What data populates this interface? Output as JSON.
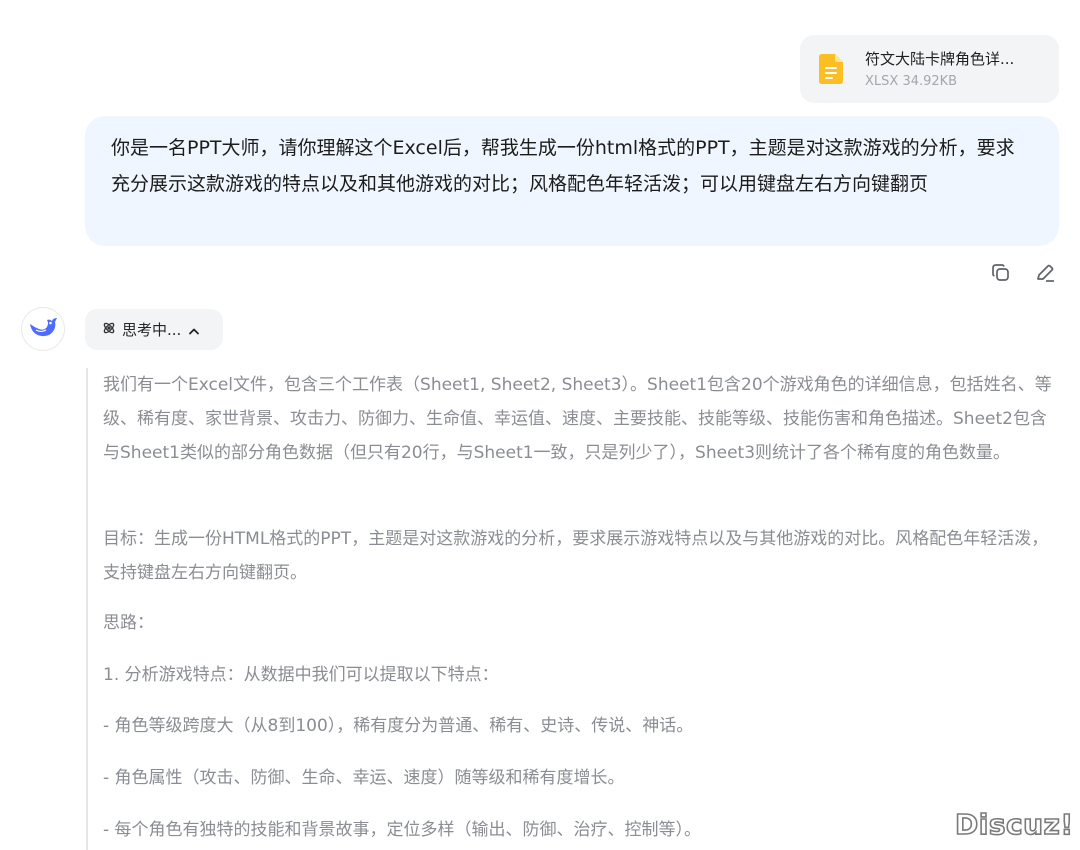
{
  "attachment": {
    "file_name": "符文大陆卡牌角色详...",
    "file_meta": "XLSX 34.92KB",
    "icon": "document-icon",
    "icon_color": "#fbbf24"
  },
  "user_message": {
    "text": "你是一名PPT大师，请你理解这个Excel后，帮我生成一份html格式的PPT，主题是对这款游戏的分析，要求充分展示这款游戏的特点以及和其他游戏的对比；风格配色年轻活泼；可以用键盘左右方向键翻页"
  },
  "message_actions": {
    "copy_icon": "copy-icon",
    "edit_icon": "edit-icon"
  },
  "assistant": {
    "avatar_icon": "whale-logo-icon",
    "brand_color": "#4d6bfe",
    "thinking_label": "思考中...",
    "thinking_icon": "atom-icon",
    "chevron_icon": "chevron-up-icon",
    "reasoning": [
      "我们有一个Excel文件，包含三个工作表（Sheet1, Sheet2, Sheet3）。Sheet1包含20个游戏角色的详细信息，包括姓名、等级、稀有度、家世背景、攻击力、防御力、生命值、幸运值、速度、主要技能、技能等级、技能伤害和角色描述。Sheet2包含与Sheet1类似的部分角色数据（但只有20行，与Sheet1一致，只是列少了），Sheet3则统计了各个稀有度的角色数量。",
      "目标：生成一份HTML格式的PPT，主题是对这款游戏的分析，要求展示游戏特点以及与其他游戏的对比。风格配色年轻活泼，支持键盘左右方向键翻页。",
      "思路：",
      "1. 分析游戏特点：从数据中我们可以提取以下特点：",
      "- 角色等级跨度大（从8到100），稀有度分为普通、稀有、史诗、传说、神话。",
      "- 角色属性（攻击、防御、生命、幸运、速度）随等级和稀有度增长。",
      "- 每个角色有独特的技能和背景故事，定位多样（输出、防御、治疗、控制等）。"
    ]
  },
  "watermark": "Discuz!"
}
